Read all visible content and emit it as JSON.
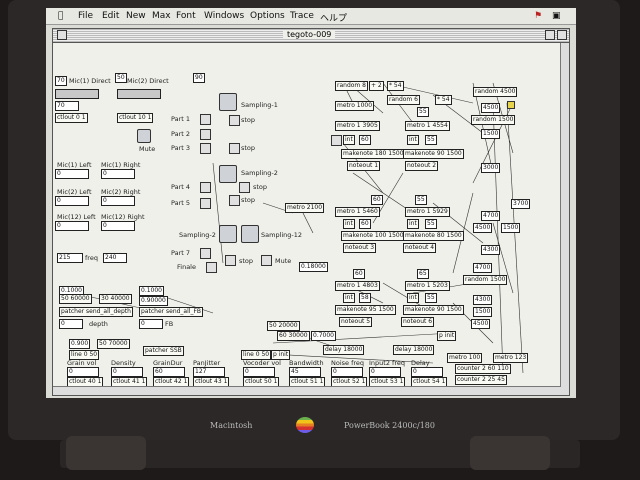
{
  "menubar": {
    "items": [
      "File",
      "Edit",
      "New",
      "Max",
      "Font",
      "Windows",
      "Options",
      "Trace",
      "ヘルプ"
    ]
  },
  "window": {
    "title": "tegoto-009"
  },
  "left": {
    "mic1_direct_val": "70",
    "mic1_direct": "Mic(1) Direct",
    "mic2_direct_val": "50",
    "mic2_direct": "Mic(2) Direct",
    "val90": "90",
    "v70": "70",
    "ctlout1": "ctlout 0 1",
    "ctlout2": "ctlout 10 1",
    "mute": "Mute",
    "mic1_left": "Mic(1) Left",
    "mic1_right": "Mic(1) Right",
    "mic2_left": "Mic(2) Left",
    "mic2_right": "Mic(2) Right",
    "mic12_left": "Mic(12) Left",
    "mic12_right": "Mic(12) Right",
    "zeros": [
      "0",
      "0",
      "0",
      "0",
      "0",
      "0"
    ],
    "freq_val": "215",
    "freq": "freq",
    "freq2": "240",
    "v1000a": "0.1000",
    "v50_60000": "50 60000",
    "v30_40000": "30 40000",
    "v1000b": "0.1000",
    "v90000": "0.90000",
    "patcher1": "patcher send_all_depth",
    "patcher2": "patcher send_all_FB",
    "depth": "depth",
    "fb": "FB",
    "v0_d": "0",
    "v0_f": "0"
  },
  "mid": {
    "part1": "Part 1",
    "part2": "Part 2",
    "part3": "Part 3",
    "part4": "Part 4",
    "part5": "Part 5",
    "part7": "Part 7",
    "finale": "Finale",
    "sampling1": "Sampling-1",
    "sampling2": "Sampling-2",
    "sampling2b": "Sampling-2",
    "sampling12": "Sampling-12",
    "stop": "stop",
    "mute": "Mute",
    "metro": "metro 2100",
    "v18000": "0.18000"
  },
  "right": {
    "random1": "random 8",
    "plus2": "+ 2",
    "times54": "* 54",
    "random6": "random 6",
    "times54b": "* 54",
    "metro1000": "metro 1000",
    "v55": "55",
    "metro3905": "metro 1 3905",
    "metro4554": "metro 1 4554",
    "int1": "int",
    "int2": "int",
    "v60": "60",
    "v55b": "55",
    "makenote1": "makenote 180 1500",
    "makenote2": "makenote 90 1500",
    "noteout1": "noteout 1",
    "noteout2": "noteout 2",
    "random_r1": "random 4500",
    "v4500": "4500",
    "random1500": "random 1500",
    "v1500": "1500",
    "v3000": "3000",
    "v60b": "60",
    "v55c": "55",
    "metro5460": "metro 1 5460",
    "metro5929": "metro 1 5929",
    "int3": "int",
    "int4": "int",
    "v60c": "60",
    "v55d": "55",
    "makenote3": "makenote 100 1500",
    "makenote4": "makenote 80 1500",
    "noteout3": "noteout 3",
    "noteout4": "noteout 4",
    "v4700": "4700",
    "v3700": "3700",
    "v4500b": "4500",
    "v1500b": "1500",
    "v4300": "4300",
    "v60d": "60",
    "v65": "65",
    "metro4803": "metro 1 4803",
    "metro5203": "metro 1 5203",
    "int5": "int",
    "int6": "int",
    "v58": "58",
    "v55e": "55",
    "makenote5": "makenote 95 1500",
    "makenote6": "makenote 90 1500",
    "noteout5": "noteout 5",
    "noteout6": "noteout 6",
    "v4700b": "4700",
    "random4700": "random 1500",
    "v4300b": "4300",
    "v4500c": "4500",
    "v1500c": "1500"
  },
  "bottom_patch": {
    "v50_20000": "50 20000",
    "v60_30000": "60 30000",
    "v7000": "0.7000",
    "v900": "0.900",
    "v50_70000": "50 70000",
    "line": "line 0 50",
    "patcher_ssb": "patcher SSB",
    "pinit": "p init",
    "delay1": "delay 18000",
    "delay2": "delay 18000",
    "pinit2": "p init",
    "metro100": "metro 100",
    "metro123": "metro 123",
    "counter1": "counter 2 60 110",
    "counter2": "counter 2 25 45",
    "labels": [
      "Grain vol",
      "Density",
      "GrainDur",
      "PanJitter",
      "Vocoder vol",
      "Bandwidth",
      "Noise freq",
      "Input2 freq",
      "Delay"
    ],
    "values": [
      "0",
      "0",
      "60",
      "127",
      "0",
      "45",
      "0",
      "0",
      "0"
    ],
    "ctlouts": [
      "ctlout 40 1",
      "ctlout 41 1",
      "ctlout 42 1",
      "ctlout 43 1",
      "ctlout 50 1",
      "ctlout 51 1",
      "ctlout 52 1",
      "ctlout 53 1",
      "ctlout 54 1"
    ]
  },
  "laptop": {
    "left_label": "Macintosh",
    "right_label": "PowerBook 2400c/180"
  }
}
